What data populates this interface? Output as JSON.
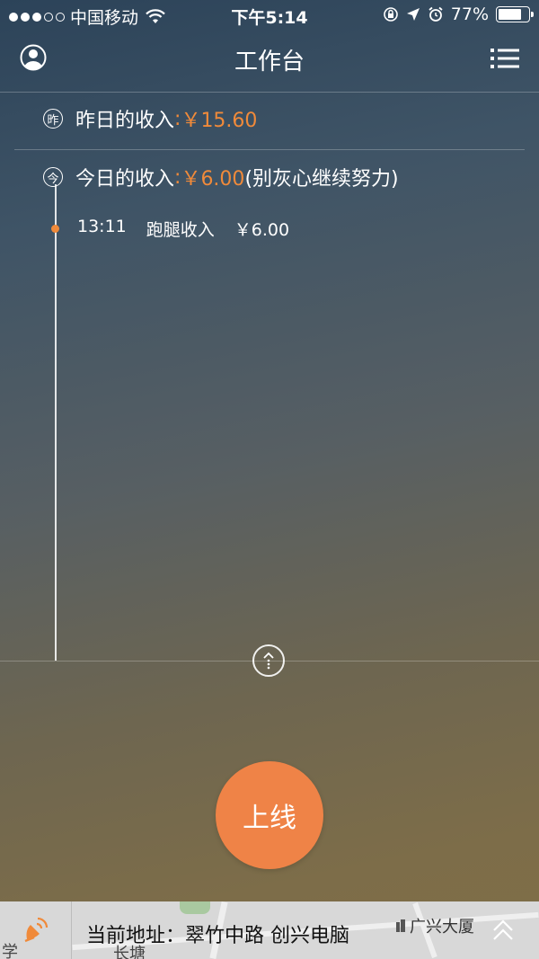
{
  "status_bar": {
    "carrier": "中国移动",
    "time": "下午5:14",
    "battery": "77%",
    "battery_level": 0.77
  },
  "header": {
    "title": "工作台"
  },
  "income": {
    "yesterday": {
      "icon_char": "昨",
      "label": "昨日的收入",
      "separator": ":",
      "amount": "￥15.60"
    },
    "today": {
      "icon_char": "今",
      "label": "今日的收入",
      "separator": ":",
      "amount": "￥6.00",
      "note": "(别灰心继续努力)"
    },
    "entries": [
      {
        "time": "13:11",
        "type": "跑腿收入",
        "amount": "￥6.00"
      }
    ]
  },
  "online_button": {
    "label": "上线"
  },
  "bottom_bar": {
    "address_label": "当前地址：",
    "address": "翠竹中路 创兴电脑",
    "poi": "广兴大厦",
    "map_labels": [
      "学",
      "长塘"
    ]
  },
  "colors": {
    "accent": "#f08a3a",
    "button": "#ef8347"
  }
}
